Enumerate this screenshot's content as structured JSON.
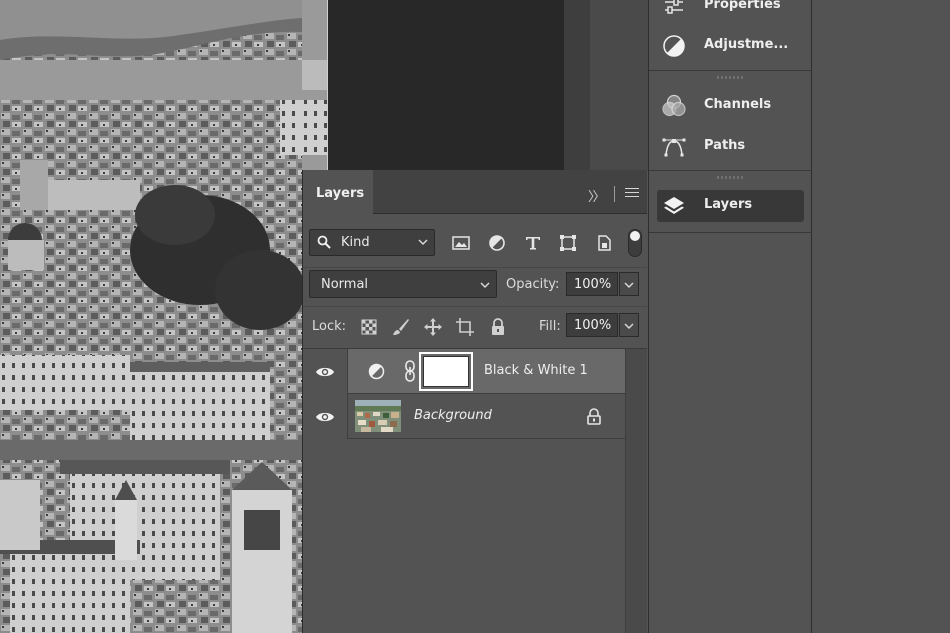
{
  "layers_panel": {
    "tab_label": "Layers",
    "collapse_glyph": "〉〉",
    "filter": {
      "kind_label": "Kind",
      "filter_icons": [
        "image-filter-icon",
        "adjustment-filter-icon",
        "type-filter-icon",
        "shape-filter-icon",
        "smart-object-filter-icon"
      ]
    },
    "blend_mode": "Normal",
    "opacity_label": "Opacity:",
    "opacity_value": "100%",
    "lock_label": "Lock:",
    "fill_label": "Fill:",
    "fill_value": "100%",
    "layers": [
      {
        "name": "Black & White 1",
        "type": "adjustment",
        "visible": true,
        "selected": true
      },
      {
        "name": "Background",
        "type": "pixel",
        "visible": true,
        "locked": true,
        "italic": true
      }
    ]
  },
  "dock": {
    "groups": [
      {
        "items": [
          {
            "label": "Properties",
            "icon": "properties-icon"
          },
          {
            "label": "Adjustme...",
            "icon": "adjustments-icon"
          }
        ]
      },
      {
        "items": [
          {
            "label": "Channels",
            "icon": "channels-icon"
          },
          {
            "label": "Paths",
            "icon": "paths-icon"
          }
        ]
      },
      {
        "items": [
          {
            "label": "Layers",
            "icon": "layers-icon",
            "active": true
          }
        ]
      }
    ]
  },
  "colors": {
    "panel_bg": "#535353",
    "tab_bar_bg": "#424242",
    "selected_layer_bg": "#696969",
    "field_bg": "#3f3f3f",
    "doc_bg": "#282828"
  }
}
